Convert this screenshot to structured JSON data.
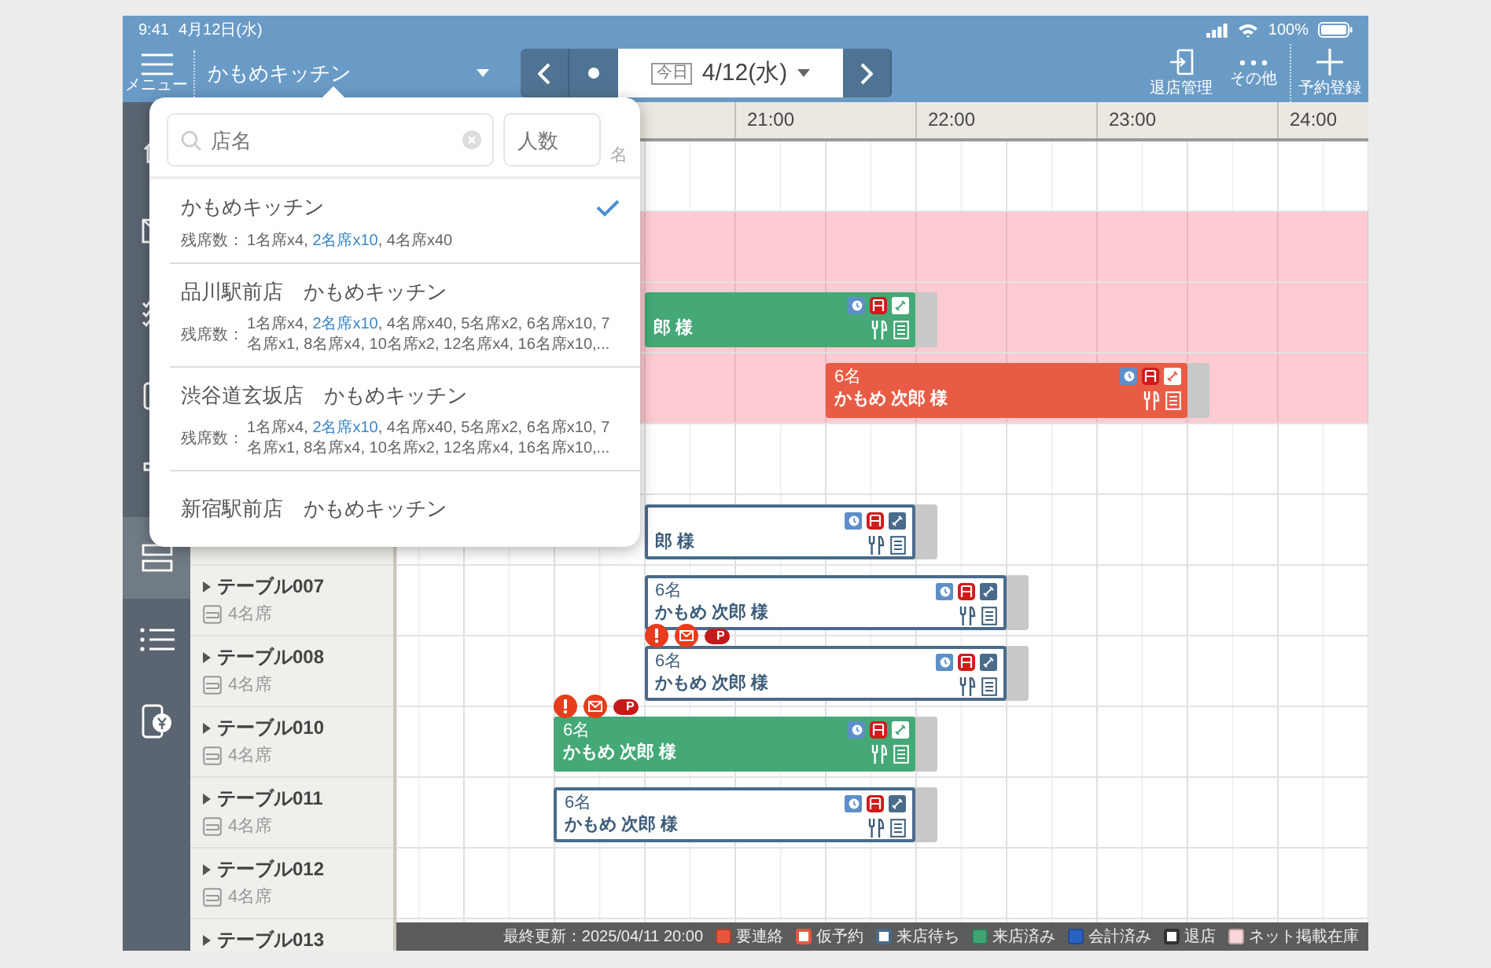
{
  "status_bar": {
    "time": "9:41",
    "date": "4月12日(水)",
    "battery": "100%"
  },
  "toolbar": {
    "menu_label": "メニュー",
    "store": "かもめキッチン",
    "today_badge": "今日",
    "date": "4/12(水)",
    "actions": [
      {
        "kind": "exit",
        "label": "退店管理"
      },
      {
        "kind": "more",
        "label": "その他"
      },
      {
        "kind": "add",
        "label": "予約登録"
      }
    ]
  },
  "sidebar": {
    "items": [
      {
        "selected": false
      },
      {
        "selected": false
      },
      {
        "selected": false
      },
      {
        "selected": false
      },
      {
        "selected": false
      },
      {
        "selected": true
      },
      {
        "selected": false
      },
      {
        "selected": false
      }
    ]
  },
  "timeline": {
    "hours": [
      "21:00",
      "22:00",
      "23:00",
      "24:00"
    ],
    "rows": [
      {
        "net_stock": false
      },
      {
        "net_stock": true
      },
      {
        "net_stock": true,
        "reservation": {
          "kind": "arrived",
          "name": "郎 様"
        }
      },
      {
        "net_stock": true,
        "reservation": {
          "kind": "contact",
          "party": "6名",
          "name": "かもめ 次郎 様"
        }
      },
      {
        "net_stock": false
      },
      {
        "net_stock": false,
        "reservation": {
          "kind": "waiting",
          "name": "郎 様"
        }
      },
      {
        "name": "テーブル007",
        "seats": "4名席",
        "net_stock": false,
        "reservation": {
          "kind": "waiting",
          "party": "6名",
          "name": "かもめ 次郎 様"
        }
      },
      {
        "name": "テーブル008",
        "seats": "4名席",
        "net_stock": false,
        "reservation": {
          "kind": "waiting",
          "party": "6名",
          "name": "かもめ 次郎 様",
          "alerts": [
            {
              "kind": "warning"
            },
            {
              "kind": "mail"
            },
            {
              "kind": "point",
              "label": "P"
            }
          ]
        }
      },
      {
        "name": "テーブル010",
        "seats": "4名席",
        "net_stock": false,
        "reservation": {
          "kind": "arrived",
          "party": "6名",
          "name": "かもめ 次郎 様",
          "alerts": [
            {
              "kind": "warning"
            },
            {
              "kind": "mail"
            },
            {
              "kind": "point",
              "label": "P"
            }
          ]
        }
      },
      {
        "name": "テーブル011",
        "seats": "4名席",
        "net_stock": false,
        "reservation": {
          "kind": "waiting",
          "party": "6名",
          "name": "かもめ 次郎 様"
        }
      },
      {
        "name": "テーブル012",
        "seats": "4名席",
        "net_stock": false
      },
      {
        "name": "テーブル013",
        "net_stock": false
      }
    ]
  },
  "store_menu": {
    "search_placeholder": "店名",
    "people_placeholder": "人数",
    "people_unit": "名",
    "stores": [
      {
        "name": "かもめキッチン",
        "selected": true,
        "seats_label": "残席数：",
        "seats": [
          {
            "text": "1名席x4, ",
            "highlight": false
          },
          {
            "text": "2名席x10",
            "highlight": true
          },
          {
            "text": ", 4名席x40",
            "highlight": false
          }
        ]
      },
      {
        "name": "品川駅前店　かもめキッチン",
        "selected": false,
        "seats_label": "残席数：",
        "seats": [
          {
            "text": "1名席x4, ",
            "highlight": false
          },
          {
            "text": "2名席x10",
            "highlight": true
          },
          {
            "text": ", 4名席x40, 5名席x2, 6名席x10, 7名席x1, 8名席x4, 10名席x2, 12名席x4, 16名席x10,...",
            "highlight": false
          }
        ]
      },
      {
        "name": "渋谷道玄坂店　かもめキッチン",
        "selected": false,
        "seats_label": "残席数：",
        "seats": [
          {
            "text": "1名席x4, ",
            "highlight": false
          },
          {
            "text": "2名席x10",
            "highlight": true
          },
          {
            "text": ", 4名席x40, 5名席x2, 6名席x10, 7名席x1, 8名席x4, 10名席x2, 12名席x4, 16名席x10,...",
            "highlight": false
          }
        ]
      },
      {
        "name": "新宿駅前店　かもめキッチン",
        "selected": false
      }
    ]
  },
  "footer": {
    "last_updated": "最終更新：2025/04/11 20:00",
    "legend": [
      {
        "label": "要連絡",
        "kind": "fill",
        "color": "#e8553f"
      },
      {
        "label": "仮予約",
        "kind": "outline",
        "color": "#e8553f"
      },
      {
        "label": "来店待ち",
        "kind": "outline",
        "color": "#4a6b8a"
      },
      {
        "label": "来店済み",
        "kind": "fill",
        "color": "#3fa573"
      },
      {
        "label": "会計済み",
        "kind": "fill",
        "color": "#2a62c4"
      },
      {
        "label": "退店",
        "kind": "outline",
        "color": "#333333"
      },
      {
        "label": "ネット掲載在庫",
        "kind": "fill",
        "color": "#f9d6da"
      }
    ]
  }
}
